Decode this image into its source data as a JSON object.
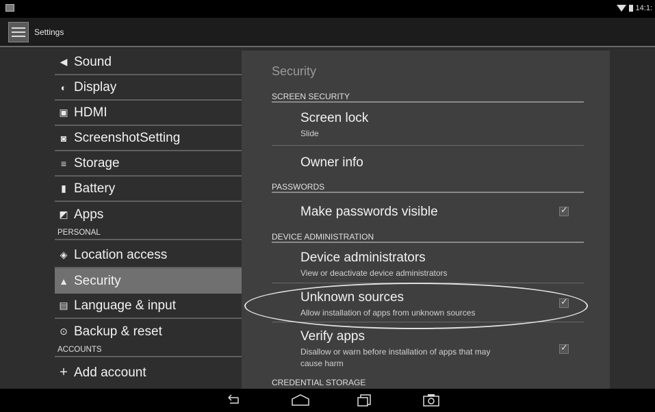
{
  "status_bar": {
    "time": "14:1:"
  },
  "action_bar": {
    "title": "Settings"
  },
  "left_pane": {
    "items": [
      {
        "label": "Sound",
        "icon": "speaker-icon"
      },
      {
        "label": "Display",
        "icon": "brightness-icon"
      },
      {
        "label": "HDMI",
        "icon": "hdmi-icon"
      },
      {
        "label": "ScreenshotSetting",
        "icon": "camera-icon"
      },
      {
        "label": "Storage",
        "icon": "storage-icon"
      },
      {
        "label": "Battery",
        "icon": "battery-icon"
      },
      {
        "label": "Apps",
        "icon": "apps-icon"
      }
    ],
    "personal_header": "PERSONAL",
    "personal_items": [
      {
        "label": "Location access",
        "icon": "location-icon"
      },
      {
        "label": "Security",
        "icon": "lock-icon",
        "selected": true
      },
      {
        "label": "Language & input",
        "icon": "keyboard-icon"
      },
      {
        "label": "Backup & reset",
        "icon": "backup-icon"
      }
    ],
    "accounts_header": "ACCOUNTS",
    "add_account": "Add account"
  },
  "right_pane": {
    "title": "Security",
    "screen_security_header": "SCREEN SECURITY",
    "screen_lock": {
      "title": "Screen lock",
      "summary": "Slide"
    },
    "owner_info": {
      "title": "Owner info"
    },
    "passwords_header": "PASSWORDS",
    "make_passwords_visible": {
      "title": "Make passwords visible",
      "checked": true
    },
    "device_admin_header": "DEVICE ADMINISTRATION",
    "device_administrators": {
      "title": "Device administrators",
      "summary": "View or deactivate device administrators"
    },
    "unknown_sources": {
      "title": "Unknown sources",
      "summary": "Allow installation of apps from unknown sources",
      "checked": true
    },
    "verify_apps": {
      "title": "Verify apps",
      "summary_line1": "Disallow or warn before installation of apps that may",
      "summary_line2": "cause harm",
      "checked": true
    },
    "credential_header": "CREDENTIAL STORAGE"
  },
  "colors": {
    "selected_bg": "#707070",
    "pane_bg": "#3f3f3f",
    "divider": "#5f5f5f"
  }
}
